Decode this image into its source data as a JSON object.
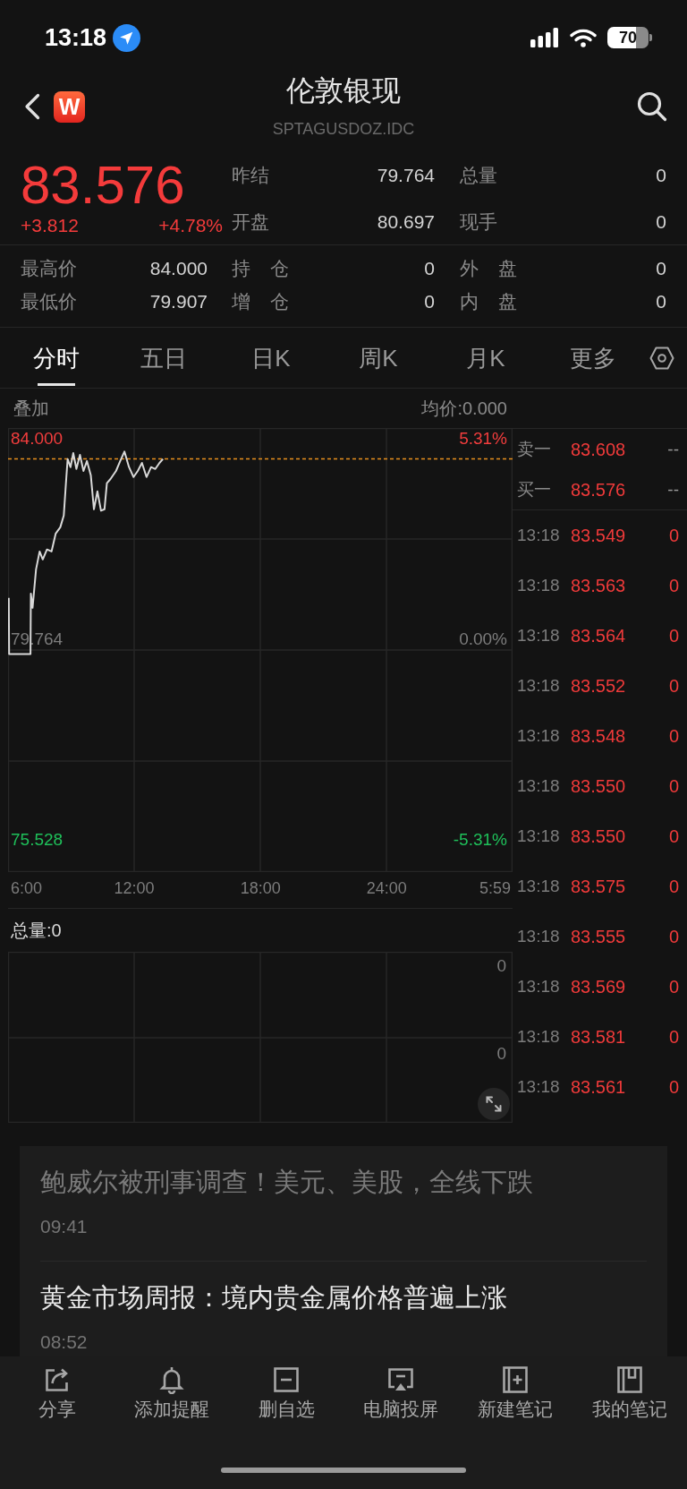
{
  "status_bar": {
    "time": "13:18",
    "battery": "70"
  },
  "header": {
    "logo_text": "W",
    "title": "伦敦银现",
    "subtitle": "SPTAGUSDOZ.IDC"
  },
  "quote": {
    "price": "83.576",
    "change": "+3.812",
    "change_pct": "+4.78%",
    "stats": [
      [
        {
          "label": "昨结",
          "value": "79.764"
        },
        {
          "label": "总量",
          "value": "0"
        }
      ],
      [
        {
          "label": "开盘",
          "value": "80.697"
        },
        {
          "label": "现手",
          "value": "0"
        }
      ]
    ]
  },
  "details": [
    [
      {
        "label": "最高价",
        "value": "84.000"
      },
      {
        "label": "持 仓",
        "value": "0"
      },
      {
        "label": "外 盘",
        "value": "0"
      }
    ],
    [
      {
        "label": "最低价",
        "value": "79.907"
      },
      {
        "label": "增 仓",
        "value": "0"
      },
      {
        "label": "内 盘",
        "value": "0"
      }
    ]
  ],
  "tabs": [
    {
      "label": "分时",
      "selected": true
    },
    {
      "label": "五日",
      "selected": false
    },
    {
      "label": "日K",
      "selected": false
    },
    {
      "label": "周K",
      "selected": false
    },
    {
      "label": "月K",
      "selected": false
    },
    {
      "label": "更多",
      "selected": false
    }
  ],
  "chart": {
    "overlay_label": "叠加",
    "avg_price": "均价:0.000",
    "percent_labels": [
      {
        "text": "5.31%",
        "color": "#f23d3d"
      },
      {
        "text": "0.00%",
        "color": "#7c7c7c"
      },
      {
        "text": "-5.31%",
        "color": "#1fc05a"
      }
    ],
    "session_end_label": "5:59",
    "chart_data": {
      "type": "line",
      "grid": true,
      "x": [
        6.033,
        6.05,
        7.067,
        7.083,
        7.167,
        7.333,
        7.5,
        7.65,
        7.85,
        8.067,
        8.267,
        8.483,
        8.65,
        8.75,
        8.833,
        8.967,
        9.1,
        9.25,
        9.417,
        9.583,
        9.75,
        9.933,
        10.083,
        10.25,
        10.417,
        10.583,
        10.7,
        10.867,
        11.133,
        11.333,
        11.533,
        11.75,
        11.967,
        12.167,
        12.367,
        12.583,
        12.8,
        13.0,
        13.2,
        13.367
      ],
      "series": [
        {
          "color": "#d9d9d9",
          "values": [
            80.64,
            79.45,
            79.45,
            80.73,
            80.43,
            81.24,
            81.62,
            81.45,
            81.66,
            81.62,
            82.0,
            82.13,
            82.38,
            83.06,
            83.57,
            83.4,
            83.7,
            83.36,
            83.66,
            83.32,
            83.53,
            83.23,
            82.51,
            82.89,
            82.48,
            82.51,
            83.06,
            83.15,
            83.32,
            83.53,
            83.73,
            83.4,
            83.19,
            83.32,
            83.49,
            83.19,
            83.4,
            83.36,
            83.49,
            83.57
          ]
        }
      ],
      "xlim": [
        6,
        29.983
      ],
      "ylim": [
        74.847,
        84.227
      ],
      "xticks": [
        {
          "value": 6,
          "label": "6:00"
        },
        {
          "value": 12,
          "label": "12:00"
        },
        {
          "value": 18,
          "label": "18:00"
        },
        {
          "value": 24,
          "label": "24:00"
        }
      ],
      "yticks": [
        {
          "value": 84.0,
          "label": "84.000"
        },
        {
          "value": 79.764,
          "label": "79.764"
        },
        {
          "value": 75.528,
          "label": "75.528"
        }
      ],
      "ref_lines": [
        {
          "axis": "y",
          "value": 83.576
        }
      ]
    }
  },
  "volume": {
    "title": "总量:0",
    "labels": [
      "0",
      "0"
    ]
  },
  "order_book": [
    {
      "label": "卖一",
      "price": "83.608",
      "volume": "--"
    },
    {
      "label": "买一",
      "price": "83.576",
      "volume": "--"
    }
  ],
  "trades": [
    {
      "time": "13:18",
      "price": "83.549",
      "volume": "0"
    },
    {
      "time": "13:18",
      "price": "83.563",
      "volume": "0"
    },
    {
      "time": "13:18",
      "price": "83.564",
      "volume": "0"
    },
    {
      "time": "13:18",
      "price": "83.552",
      "volume": "0"
    },
    {
      "time": "13:18",
      "price": "83.548",
      "volume": "0"
    },
    {
      "time": "13:18",
      "price": "83.550",
      "volume": "0"
    },
    {
      "time": "13:18",
      "price": "83.550",
      "volume": "0"
    },
    {
      "time": "13:18",
      "price": "83.575",
      "volume": "0"
    },
    {
      "time": "13:18",
      "price": "83.555",
      "volume": "0"
    },
    {
      "time": "13:18",
      "price": "83.569",
      "volume": "0"
    },
    {
      "time": "13:18",
      "price": "83.581",
      "volume": "0"
    },
    {
      "time": "13:18",
      "price": "83.561",
      "volume": "0"
    }
  ],
  "news": [
    {
      "title": "鲍威尔被刑事调查！美元、美股，全线下跌",
      "time": "09:41",
      "read": true
    },
    {
      "title": "黄金市场周报：境内贵金属价格普遍上涨",
      "time": "08:52",
      "read": false
    }
  ],
  "toolbar": [
    {
      "kind": "share",
      "label": "分享"
    },
    {
      "kind": "alert",
      "label": "添加提醒"
    },
    {
      "kind": "remove",
      "label": "删自选"
    },
    {
      "kind": "cast",
      "label": "电脑投屏"
    },
    {
      "kind": "new_note",
      "label": "新建笔记"
    },
    {
      "kind": "notes",
      "label": "我的笔记"
    }
  ]
}
